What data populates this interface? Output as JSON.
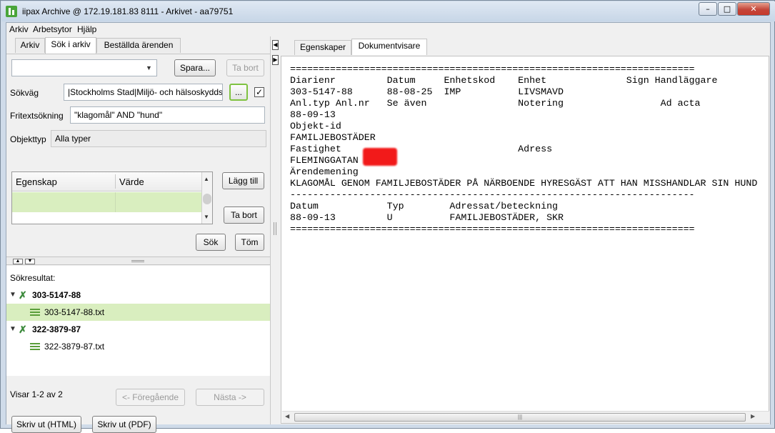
{
  "window": {
    "title": "iipax Archive @ 172.19.181.83 8111 - Arkivet - aa79751"
  },
  "menu": [
    "Arkiv",
    "Arbetsytor",
    "Hjälp"
  ],
  "left_tabs": [
    "Arkiv",
    "Sök i arkiv",
    "Beställda ärenden"
  ],
  "search": {
    "saved_query_value": "",
    "save_label": "Spara...",
    "remove_label": "Ta bort",
    "path_label": "Sökväg",
    "path_value": "|Stockholms Stad|Miljö- och hälsoskyddsnämnden",
    "browse_label": "...",
    "fulltext_label": "Fritextsökning",
    "fulltext_value": "\"klagomål\" AND \"hund\"",
    "objtype_label": "Objekttyp",
    "objtype_value": "Alla typer",
    "property_col": "Egenskap",
    "value_col": "Värde",
    "add_label": "Lägg till",
    "remove_prop_label": "Ta bort",
    "search_label": "Sök",
    "clear_label": "Töm"
  },
  "results": {
    "title": "Sökresultat:",
    "items": [
      {
        "case": "303-5147-88",
        "file": "303-5147-88.txt"
      },
      {
        "case": "322-3879-87",
        "file": "322-3879-87.txt"
      }
    ],
    "count_text": "Visar 1-2 av 2",
    "prev_label": "<- Föregående",
    "next_label": "Nästa ->",
    "print_html_label": "Skriv ut (HTML)",
    "print_pdf_label": "Skriv ut (PDF)"
  },
  "right_tabs": [
    "Egenskaper",
    "Dokumentvisare"
  ],
  "document_lines": [
    "=======================================================================",
    "Diarienr         Datum     Enhetskod    Enhet              Sign Handläggare",
    "303-5147-88      88-08-25  IMP          LIVSMAVD",
    "Anl.typ Anl.nr   Se även                Notering                 Ad acta",
    "88-09-13",
    "Objekt-id",
    "FAMILJEBOSTÄDER",
    "Fastighet                               Adress",
    "FLEMINGGATAN",
    "Ärendemening",
    "KLAGOMÅL GENOM FAMILJEBOSTÄDER PÅ NÄRBOENDE HYRESGÄST ATT HAN MISSHANDLAR SIN HUND",
    "-----------------------------------------------------------------------",
    "Datum            Typ        Adressat/beteckning",
    "88-09-13         U          FAMILJEBOSTÄDER, SKR",
    "======================================================================="
  ]
}
